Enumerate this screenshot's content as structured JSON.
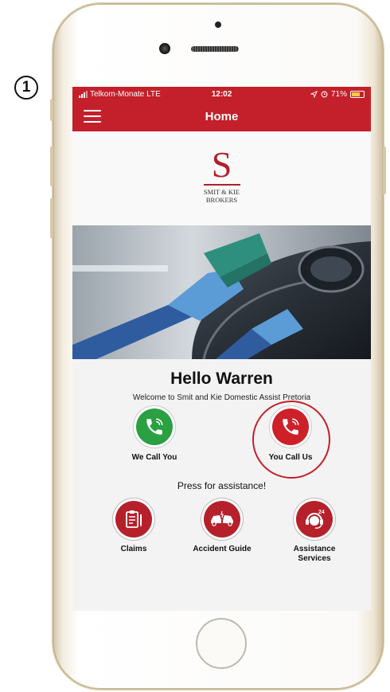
{
  "step_marker": "1",
  "status": {
    "carrier": "Telkom-Monate  LTE",
    "time": "12:02",
    "battery_text": "71%",
    "battery_level": 0.71
  },
  "navbar": {
    "title": "Home"
  },
  "logo": {
    "letter": "S",
    "line1": "SMIT & KIE",
    "line2": "BROKERS"
  },
  "greeting": "Hello Warren",
  "welcome": "Welcome to Smit and Kie Domestic Assist Pretoria",
  "call_buttons": [
    {
      "label": "We Call You",
      "color": "#2aa042",
      "icon": "phone-icon"
    },
    {
      "label": "You Call Us",
      "color": "#cd2029",
      "icon": "phone-icon"
    }
  ],
  "press_text": "Press for assistance!",
  "actions": [
    {
      "label": "Claims",
      "icon": "clipboard-pen-icon"
    },
    {
      "label": "Accident Guide",
      "icon": "car-crash-icon"
    },
    {
      "label": "Assistance\nServices",
      "icon": "headset-24-icon",
      "badge": "24"
    }
  ],
  "colors": {
    "brand_red": "#c3202b",
    "green": "#2aa042"
  }
}
